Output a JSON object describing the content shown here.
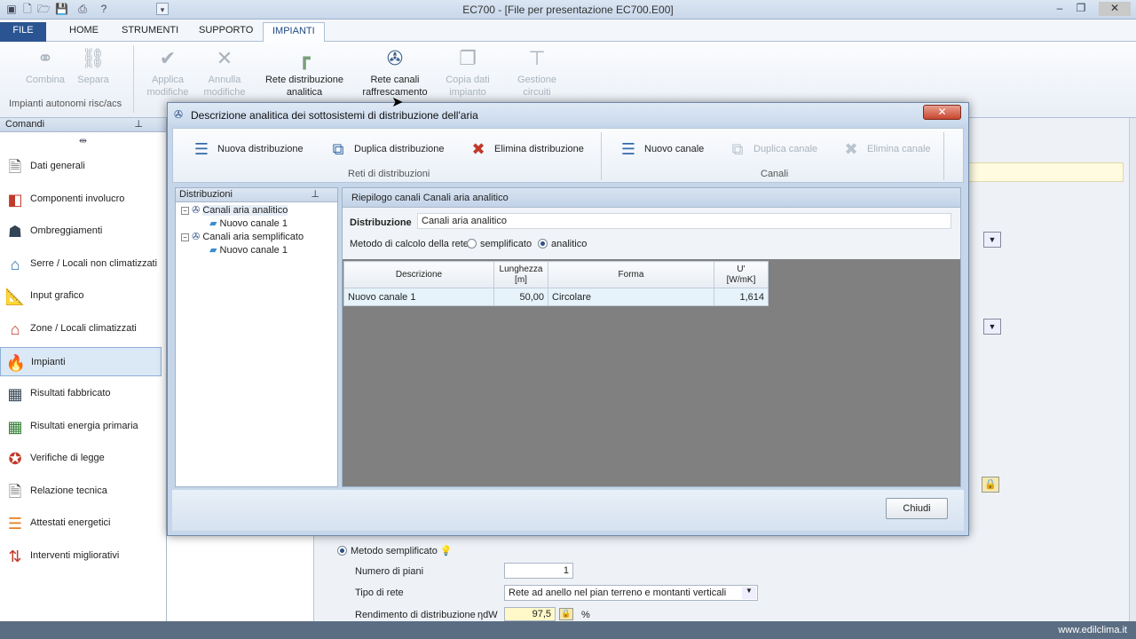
{
  "window": {
    "title": "EC700 - [File per presentazione EC700.E00]"
  },
  "ribbon": {
    "tabs": [
      "FILE",
      "HOME",
      "STRUMENTI",
      "SUPPORTO",
      "IMPIANTI"
    ],
    "buttons": {
      "combina": "Combina",
      "separa": "Separa",
      "applica_1": "Applica",
      "applica_2": "modifiche",
      "annulla_1": "Annulla",
      "annulla_2": "modifiche",
      "rete_dist_1": "Rete distribuzione",
      "rete_dist_2": "analitica",
      "rete_canali_1": "Rete canali",
      "rete_canali_2": "raffrescamento",
      "copia_1": "Copia dati",
      "copia_2": "impianto",
      "gestione_1": "Gestione",
      "gestione_2": "circuiti"
    },
    "group_label": "Impianti autonomi risc/acs"
  },
  "sidebar": {
    "header": "Comandi",
    "items": [
      {
        "label": "Dati generali",
        "icon": "document-icon"
      },
      {
        "label": "Componenti involucro",
        "icon": "components-icon"
      },
      {
        "label": "Ombreggiamenti",
        "icon": "shading-icon"
      },
      {
        "label": "Serre / Locali non climatizzati",
        "icon": "greenhouse-icon"
      },
      {
        "label": "Input grafico",
        "icon": "drawing-icon"
      },
      {
        "label": "Zone / Locali climatizzati",
        "icon": "house-icon"
      },
      {
        "label": "Impianti",
        "icon": "flame-icon"
      },
      {
        "label": "Risultati fabbricato",
        "icon": "calculator-icon"
      },
      {
        "label": "Risultati energia primaria",
        "icon": "calculator-icon"
      },
      {
        "label": "Verifiche di legge",
        "icon": "star-seal-icon"
      },
      {
        "label": "Relazione tecnica",
        "icon": "report-icon"
      },
      {
        "label": "Attestati energetici",
        "icon": "energy-bars-icon"
      },
      {
        "label": "Interventi migliorativi",
        "icon": "improvement-icon"
      }
    ]
  },
  "dialog": {
    "title": "Descrizione analitica dei sottosistemi di distribuzione dell'aria",
    "toolbar": {
      "nuova": "Nuova distribuzione",
      "duplica": "Duplica distribuzione",
      "elimina": "Elimina distribuzione",
      "group1": "Reti di distribuzioni",
      "nuovo_canale": "Nuovo canale",
      "duplica_canale": "Duplica canale",
      "elimina_canale": "Elimina canale",
      "group2": "Canali"
    },
    "tree": {
      "header": "Distribuzioni",
      "nodes": [
        {
          "label": "Canali aria analitico",
          "child": "Nuovo canale 1"
        },
        {
          "label": "Canali aria semplificato",
          "child": "Nuovo canale 1"
        }
      ]
    },
    "main": {
      "header": "Riepilogo canali Canali aria analitico",
      "distribuzione_label": "Distribuzione",
      "distribuzione_value": "Canali aria analitico",
      "metodo_label": "Metodo di calcolo della rete",
      "opt_semplificato": "semplificato",
      "opt_analitico": "analitico",
      "columns": [
        "Descrizione",
        "Lunghezza\n[m]",
        "Forma",
        "U'\n[W/mK]"
      ],
      "col_lunghezza_1": "Lunghezza",
      "col_lunghezza_2": "[m]",
      "col_u_1": "U'",
      "col_u_2": "[W/mK]",
      "rows": [
        {
          "descrizione": "Nuovo canale 1",
          "lunghezza": "50,00",
          "forma": "Circolare",
          "u": "1,614"
        }
      ]
    },
    "close_label": "Chiudi"
  },
  "background": {
    "metodo": "Metodo semplificato",
    "piani_label": "Numero di piani",
    "piani_value": "1",
    "rete_label": "Tipo di rete",
    "rete_value": "Rete ad anello nel pian terreno e montanti verticali",
    "rend_label": "Rendimento di distribuzione",
    "rend_sym": "ηdW",
    "rend_value": "97,5",
    "rend_unit": "%"
  },
  "status": {
    "website": "www.edilclima.it"
  }
}
